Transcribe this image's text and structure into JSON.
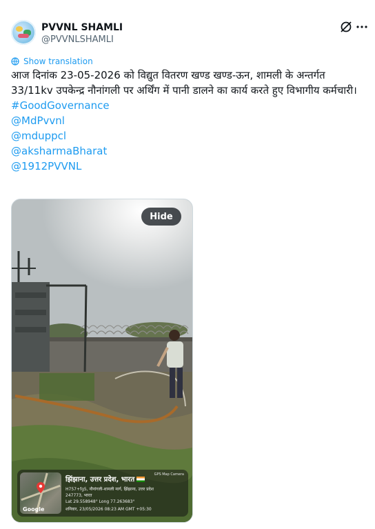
{
  "author": {
    "display_name": "PVVNL SHAMLI",
    "handle": "@PVVNLSHAMLI",
    "avatar_icon": "avatar-logo"
  },
  "header_icons": [
    "grok-icon",
    "more-icon"
  ],
  "show_translation": "Show translation",
  "tweet_text": "आज दिनांक 23-05-2026 को विद्युत वितरण खण्ड खण्ड-ऊन, शामली के अन्तर्गत 33/11kv उपकेन्द्र नौनांगली पर अर्थिंग में पानी डालने का कार्य करते हुए विभागीय कर्मचारी।",
  "hashtags_mentions": [
    "#GoodGovernance",
    "@MdPvvnl",
    "@mduppcl",
    "@aksharmaBharat",
    "@1912PVVNL"
  ],
  "media": {
    "hide_label": "Hide",
    "overlay": {
      "camera_label": "GPS Map Camera",
      "place": "झिंझाना, उत्तर प्रदेश, भारत",
      "address_line1": "H757+fg5, नौनांगली-शामली मार्ग, झिंझाना, उत्तर प्रदेश",
      "address_line2": "247773, भारत",
      "coords": "Lat 29.558948° Long 77.263683°",
      "datetime": "शनिवार, 23/05/2026 08:23 AM GMT +05:30",
      "map_brand": "Google"
    }
  },
  "colors": {
    "link": "#1d9bf0",
    "text": "#0f1419",
    "secondary": "#536471"
  }
}
